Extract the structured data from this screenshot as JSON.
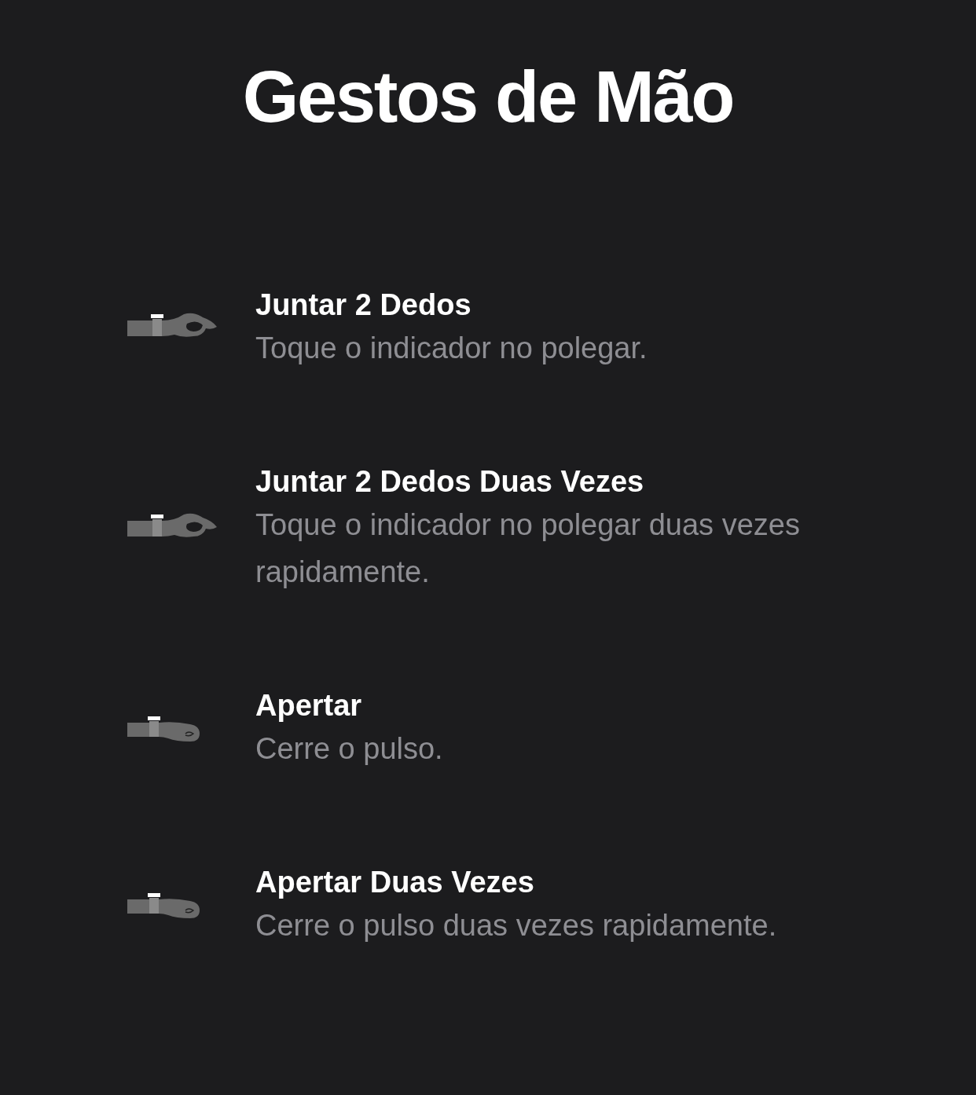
{
  "title": "Gestos de Mão",
  "gestures": [
    {
      "kind": "pinch",
      "name": "Juntar 2 Dedos",
      "description": "Toque o indicador no polegar."
    },
    {
      "kind": "pinch",
      "name": "Juntar 2 Dedos Duas Vezes",
      "description": "Toque o indicador no polegar duas vezes rapidamente."
    },
    {
      "kind": "clench",
      "name": "Apertar",
      "description": "Cerre o pulso."
    },
    {
      "kind": "clench",
      "name": "Apertar Duas Vezes",
      "description": "Cerre o pulso duas vezes rapidamente."
    }
  ]
}
